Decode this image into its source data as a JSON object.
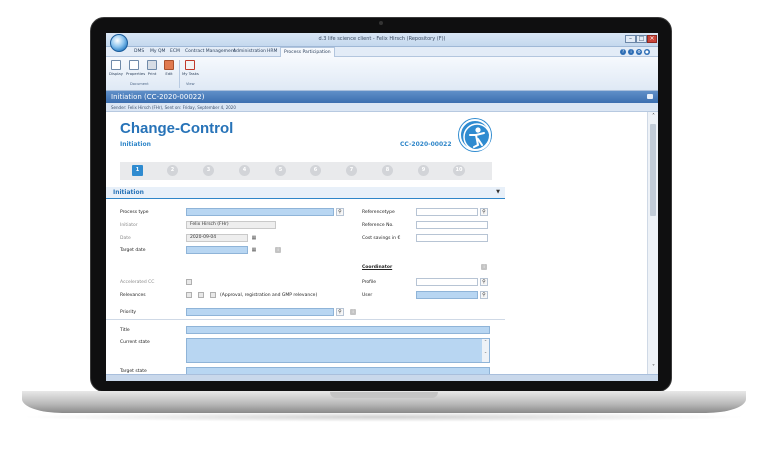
{
  "window": {
    "title": "d.3 life science client - Felix Hirsch (Repository (F))"
  },
  "menu": {
    "items": [
      "DMS",
      "My QM",
      "ECM",
      "Contract Management",
      "Administration",
      "HRM",
      "Process Participation"
    ],
    "active": "Process Participation"
  },
  "ribbon": {
    "buttons": [
      "Display",
      "Properties",
      "Print",
      "Edit",
      "My Tasks"
    ],
    "groups": [
      "Document",
      "View"
    ]
  },
  "document": {
    "header": "Initiation (CC-2020-00022)",
    "sender": "Sender: Felix Hirsch (FHr), Sent on: Friday, September 4, 2020"
  },
  "form": {
    "title": "Change-Control",
    "subtitle": "Initiation",
    "id": "CC-2020-00022",
    "steps": [
      "1",
      "2",
      "3",
      "4",
      "5",
      "6",
      "7",
      "8",
      "9",
      "10"
    ],
    "active_step": "1",
    "section_title": "Initiation",
    "labels": {
      "process_type": "Process type",
      "initiator": "Initiator",
      "date": "Date",
      "target_date": "Target date",
      "accelerated_cc": "Accelerated CC",
      "relevances": "Relevances",
      "priority": "Priority",
      "reference_type": "Referencetype",
      "reference_no": "Reference No.",
      "cost_savings": "Cost savings in €",
      "coordinator": "Coordinator",
      "profile": "Profile",
      "user": "User",
      "title": "Title",
      "current_state": "Current state",
      "target_state": "Target state"
    },
    "values": {
      "initiator": "Felix Hirsch (FHr)",
      "date": "2020-09-04"
    },
    "relevance_note": "(Approval, registration and GMP relevance)"
  },
  "icons": {
    "search": "magnifier-icon",
    "calendar": "calendar-icon",
    "info": "info-icon"
  },
  "colors": {
    "accent": "#2f86c9",
    "required_field": "#b8d6f2",
    "doc_bar": "#3c6fb0"
  }
}
